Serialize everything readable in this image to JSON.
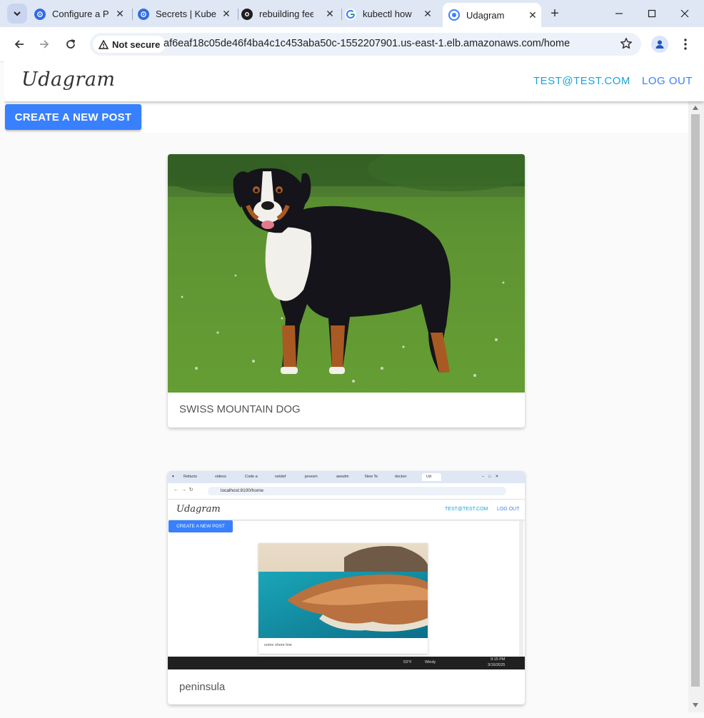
{
  "browser": {
    "tabs": [
      {
        "title": "Configure a P",
        "active": false
      },
      {
        "title": "Secrets | Kube",
        "active": false
      },
      {
        "title": "rebuilding fee",
        "active": false
      },
      {
        "title": "kubectl how t",
        "active": false
      },
      {
        "title": "Udagram",
        "active": true
      }
    ],
    "security_label": "Not secure",
    "url": "af6eaf18c05de46f4ba4c1c453aba50c-1552207901.us-east-1.elb.amazonaws.com/home",
    "colors": {
      "tabbar": "#dfe7f5",
      "accent": "#3880ff"
    }
  },
  "app": {
    "brand": "Udagram",
    "nav": {
      "user": "TEST@TEST.COM",
      "logout": "LOG OUT",
      "user_color": "#19a4d8",
      "logout_color": "#3880ff"
    },
    "create_button": "CREATE A NEW POST",
    "feed": [
      {
        "caption": "SWISS MOUNTAIN DOG",
        "image": "photo of a Swiss mountain dog standing on grass"
      },
      {
        "caption": "peninsula",
        "image": "screenshot of the Udagram app running on localhost"
      }
    ]
  },
  "nested_screenshot": {
    "url": "localhost:8100/home",
    "brand": "Udagram",
    "user": "TEST@TEST.COM",
    "logout": "LOG OUT",
    "create_button": "CREATE A NEW POST",
    "caption": "some shore line",
    "tabs": [
      "Refacto",
      "videos",
      "Code a",
      "netdef",
      "jenesm",
      "awsdm",
      "New Te",
      "docker",
      "Ud"
    ],
    "taskbar": {
      "weather": "53°F",
      "condition": "Windy",
      "time": "9:15 PM",
      "date": "3/16/2025"
    }
  }
}
